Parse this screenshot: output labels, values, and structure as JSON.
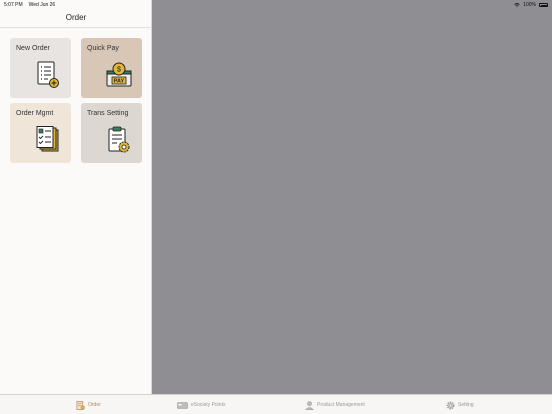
{
  "status": {
    "time": "5:07 PM",
    "date": "Wed Jun 26",
    "battery": "100%"
  },
  "nav": {
    "title": "Order"
  },
  "tiles": [
    {
      "label": "New Order",
      "icon": "new-order-icon",
      "bg": "#e8e4e1"
    },
    {
      "label": "Quick Pay",
      "icon": "quick-pay-icon",
      "bg": "#d8c7b7"
    },
    {
      "label": "Order Mgmt",
      "icon": "order-mgmt-icon",
      "bg": "#efe5d9"
    },
    {
      "label": "Trans Setting",
      "icon": "trans-setting-icon",
      "bg": "#dcd7d0"
    }
  ],
  "tabs": [
    {
      "label": "Order",
      "icon": "order-tab-icon",
      "active": true
    },
    {
      "label": "eSociety Points",
      "icon": "esociety-points-icon",
      "active": false
    },
    {
      "label": "Product Management",
      "icon": "product-management-icon",
      "active": false
    },
    {
      "label": "Setting",
      "icon": "gear-icon",
      "active": false
    }
  ],
  "colors": {
    "active_tab": "#b08a5a",
    "inactive_tab": "#9a9a9a",
    "detail_bg": "#8e8e93"
  }
}
